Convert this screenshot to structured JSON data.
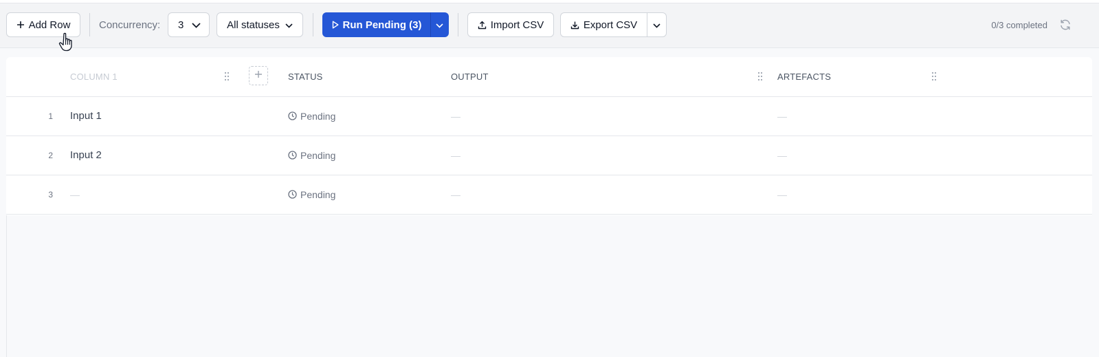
{
  "toolbar": {
    "add_row_label": "Add Row",
    "concurrency_label": "Concurrency:",
    "concurrency_value": "3",
    "status_filter_value": "All statuses",
    "run_label": "Run Pending (3)",
    "import_label": "Import CSV",
    "export_label": "Export CSV",
    "progress_text": "0/3 completed"
  },
  "table": {
    "columns": [
      "COLUMN 1",
      "STATUS",
      "OUTPUT",
      "ARTEFACTS"
    ],
    "rows": [
      {
        "num": "1",
        "input": "Input 1",
        "status": "Pending",
        "output": "—",
        "artefacts": "—"
      },
      {
        "num": "2",
        "input": "Input 2",
        "status": "Pending",
        "output": "—",
        "artefacts": "—"
      },
      {
        "num": "3",
        "input": "—",
        "status": "Pending",
        "output": "—",
        "artefacts": "—"
      }
    ]
  },
  "colors": {
    "primary": "#2557d6",
    "border": "#d1d5db",
    "muted_text": "#6b7280",
    "background": "#f8f9fb"
  },
  "icons": [
    "plus-icon",
    "chevron-down-icon",
    "play-icon",
    "upload-icon",
    "download-icon",
    "refresh-icon",
    "grip-icon",
    "clock-icon",
    "hand-cursor-icon"
  ]
}
